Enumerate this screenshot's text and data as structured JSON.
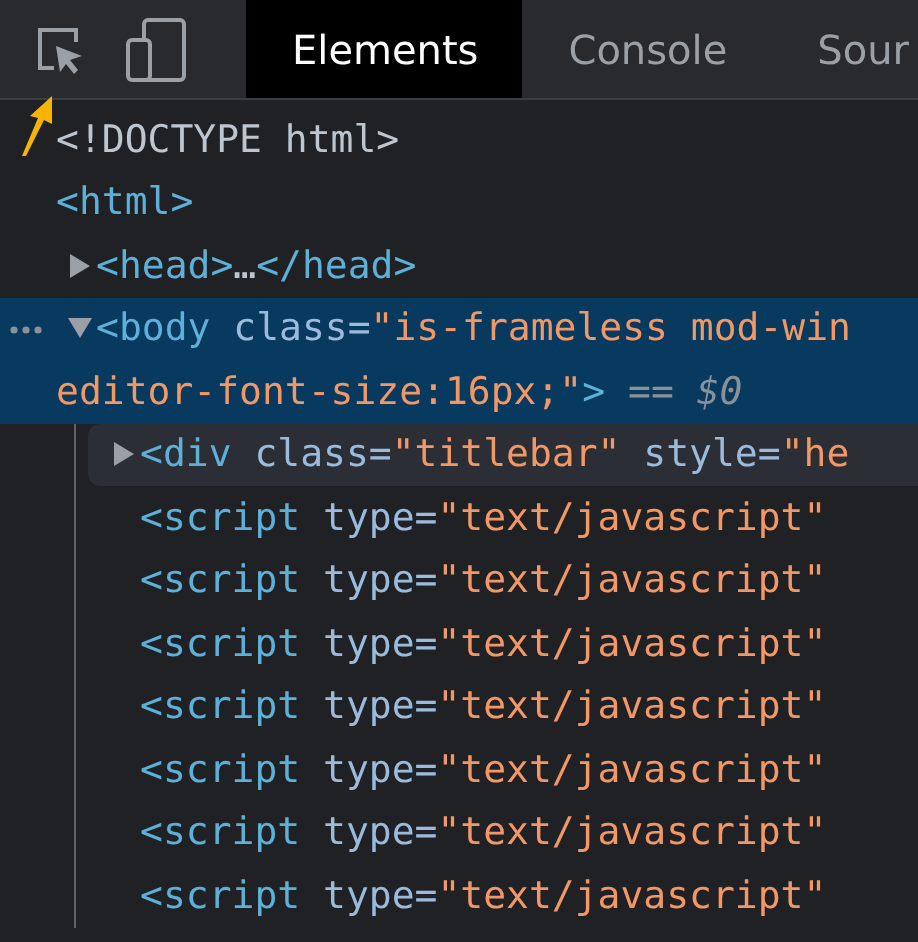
{
  "toolbar": {
    "icons": [
      {
        "kind": "inspect",
        "selected": false
      },
      {
        "kind": "device",
        "selected": false
      }
    ],
    "tabs": [
      {
        "label": "Elements",
        "selected": true
      },
      {
        "label": "Console",
        "selected": false
      },
      {
        "label": "Sour",
        "selected": false
      }
    ]
  },
  "annotation": {
    "kind": "arrow"
  },
  "dom_tree": [
    {
      "expandable": false,
      "selected": false,
      "hovered": false,
      "lines": [
        [
          {
            "kind": "plain",
            "text": "<!DOCTYPE html>"
          }
        ]
      ]
    },
    {
      "expandable": false,
      "selected": false,
      "hovered": false,
      "lines": [
        [
          {
            "kind": "tag",
            "text": "<html>"
          }
        ]
      ],
      "children": [
        {
          "expandable": true,
          "expanded": false,
          "selected": false,
          "hovered": false,
          "lines": [
            [
              {
                "kind": "tag",
                "text": "<head>"
              },
              {
                "kind": "plain",
                "text": "…"
              },
              {
                "kind": "tag",
                "text": "</head>"
              }
            ]
          ]
        },
        {
          "expandable": true,
          "expanded": true,
          "selected": true,
          "hovered": false,
          "lines": [
            [
              {
                "kind": "tag",
                "text": "<body"
              },
              {
                "kind": "attr",
                "text": " class="
              },
              {
                "kind": "value",
                "text": "\"is-frameless mod-win"
              }
            ],
            [
              {
                "kind": "value",
                "text": "editor-font-size:16px;\""
              },
              {
                "kind": "tag",
                "text": ">"
              },
              {
                "kind": "ref",
                "text": " == $0"
              }
            ]
          ],
          "children": [
            {
              "expandable": true,
              "expanded": false,
              "selected": false,
              "hovered": true,
              "lines": [
                [
                  {
                    "kind": "tag",
                    "text": "<div"
                  },
                  {
                    "kind": "attr",
                    "text": " class="
                  },
                  {
                    "kind": "value",
                    "text": "\"titlebar\""
                  },
                  {
                    "kind": "attr",
                    "text": " style="
                  },
                  {
                    "kind": "value",
                    "text": "\"he"
                  }
                ]
              ]
            },
            {
              "expandable": false,
              "selected": false,
              "hovered": false,
              "lines": [
                [
                  {
                    "kind": "tag",
                    "text": "<script"
                  },
                  {
                    "kind": "attr",
                    "text": " type="
                  },
                  {
                    "kind": "value",
                    "text": "\"text/javascript\""
                  }
                ]
              ]
            },
            {
              "expandable": false,
              "selected": false,
              "hovered": false,
              "lines": [
                [
                  {
                    "kind": "tag",
                    "text": "<script"
                  },
                  {
                    "kind": "attr",
                    "text": " type="
                  },
                  {
                    "kind": "value",
                    "text": "\"text/javascript\""
                  }
                ]
              ]
            },
            {
              "expandable": false,
              "selected": false,
              "hovered": false,
              "lines": [
                [
                  {
                    "kind": "tag",
                    "text": "<script"
                  },
                  {
                    "kind": "attr",
                    "text": " type="
                  },
                  {
                    "kind": "value",
                    "text": "\"text/javascript\""
                  }
                ]
              ]
            },
            {
              "expandable": false,
              "selected": false,
              "hovered": false,
              "lines": [
                [
                  {
                    "kind": "tag",
                    "text": "<script"
                  },
                  {
                    "kind": "attr",
                    "text": " type="
                  },
                  {
                    "kind": "value",
                    "text": "\"text/javascript\""
                  }
                ]
              ]
            },
            {
              "expandable": false,
              "selected": false,
              "hovered": false,
              "lines": [
                [
                  {
                    "kind": "tag",
                    "text": "<script"
                  },
                  {
                    "kind": "attr",
                    "text": " type="
                  },
                  {
                    "kind": "value",
                    "text": "\"text/javascript\""
                  }
                ]
              ]
            },
            {
              "expandable": false,
              "selected": false,
              "hovered": false,
              "lines": [
                [
                  {
                    "kind": "tag",
                    "text": "<script"
                  },
                  {
                    "kind": "attr",
                    "text": " type="
                  },
                  {
                    "kind": "value",
                    "text": "\"text/javascript\""
                  }
                ]
              ]
            },
            {
              "expandable": false,
              "selected": false,
              "hovered": false,
              "lines": [
                [
                  {
                    "kind": "tag",
                    "text": "<script"
                  },
                  {
                    "kind": "attr",
                    "text": " type="
                  },
                  {
                    "kind": "value",
                    "text": "\"text/javascript\""
                  }
                ]
              ]
            }
          ]
        }
      ]
    }
  ]
}
